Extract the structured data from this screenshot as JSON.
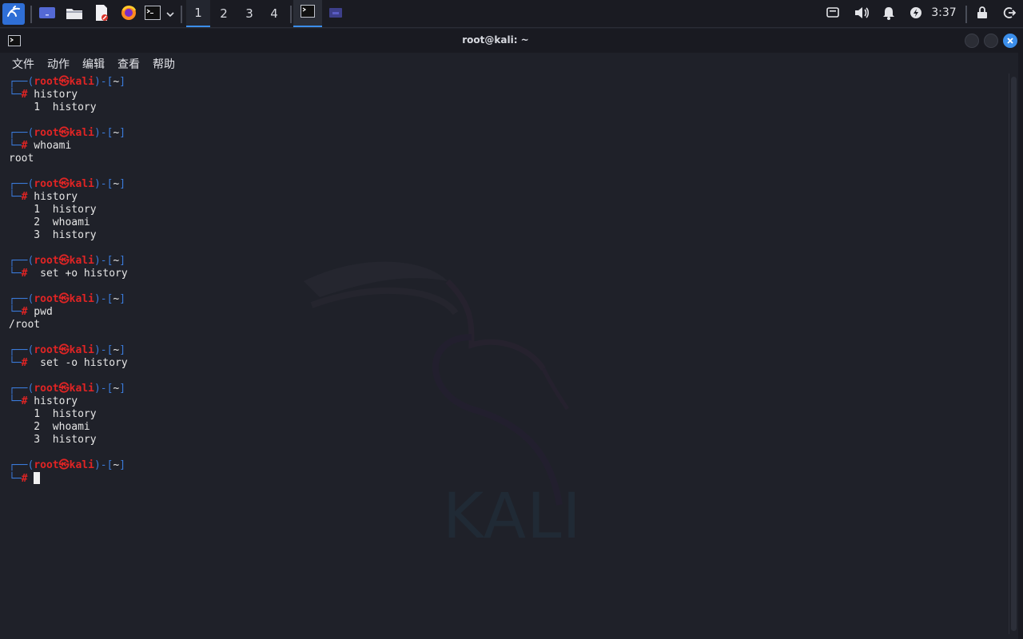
{
  "panel": {
    "workspaces": [
      "1",
      "2",
      "3",
      "4"
    ],
    "active_workspace": "1",
    "clock": "3:37",
    "icons": {
      "menu": "kali-dragon-icon",
      "show_desktop": "desktop-icon",
      "files": "file-manager-icon",
      "editor": "text-editor-icon",
      "browser": "firefox-icon",
      "terminal": "terminal-icon",
      "dropdown": "chevron-down-icon",
      "display": "display-icon",
      "volume": "volume-icon",
      "notifications": "bell-icon",
      "power_mgr": "power-manager-icon",
      "lock": "lock-icon",
      "logout": "logout-icon"
    },
    "accent": "#3b8eea"
  },
  "window": {
    "title": "root@kali: ~",
    "menus": [
      "文件",
      "动作",
      "编辑",
      "查看",
      "帮助"
    ]
  },
  "terminal": {
    "colors": {
      "prompt_frame": "#3a7ad9",
      "prompt_user": "#e02424",
      "text": "#e6e6e6",
      "background": "#1f2129"
    },
    "prompt": {
      "top_left": "┌──(",
      "user": "root㉿kali",
      "top_right": ")-[",
      "dir": "~",
      "close": "]",
      "bottom": "└─",
      "hash": "#"
    },
    "lines": [
      {
        "type": "prompt"
      },
      {
        "type": "cmd",
        "text": " history"
      },
      {
        "type": "out",
        "text": "    1  history"
      },
      {
        "type": "blank"
      },
      {
        "type": "prompt"
      },
      {
        "type": "cmd",
        "text": " whoami"
      },
      {
        "type": "out",
        "text": "root"
      },
      {
        "type": "blank"
      },
      {
        "type": "prompt"
      },
      {
        "type": "cmd",
        "text": " history"
      },
      {
        "type": "out",
        "text": "    1  history"
      },
      {
        "type": "out",
        "text": "    2  whoami"
      },
      {
        "type": "out",
        "text": "    3  history"
      },
      {
        "type": "blank"
      },
      {
        "type": "prompt"
      },
      {
        "type": "cmd",
        "text": "  set +o history"
      },
      {
        "type": "blank"
      },
      {
        "type": "prompt"
      },
      {
        "type": "cmd",
        "text": " pwd"
      },
      {
        "type": "out",
        "text": "/root"
      },
      {
        "type": "blank"
      },
      {
        "type": "prompt"
      },
      {
        "type": "cmd",
        "text": "  set -o history"
      },
      {
        "type": "blank"
      },
      {
        "type": "prompt"
      },
      {
        "type": "cmd",
        "text": " history"
      },
      {
        "type": "out",
        "text": "    1  history"
      },
      {
        "type": "out",
        "text": "    2  whoami"
      },
      {
        "type": "out",
        "text": "    3  history"
      },
      {
        "type": "blank"
      },
      {
        "type": "prompt"
      },
      {
        "type": "cursor",
        "text": " "
      }
    ]
  },
  "wallpaper": {
    "watermark_text": "KALI"
  }
}
